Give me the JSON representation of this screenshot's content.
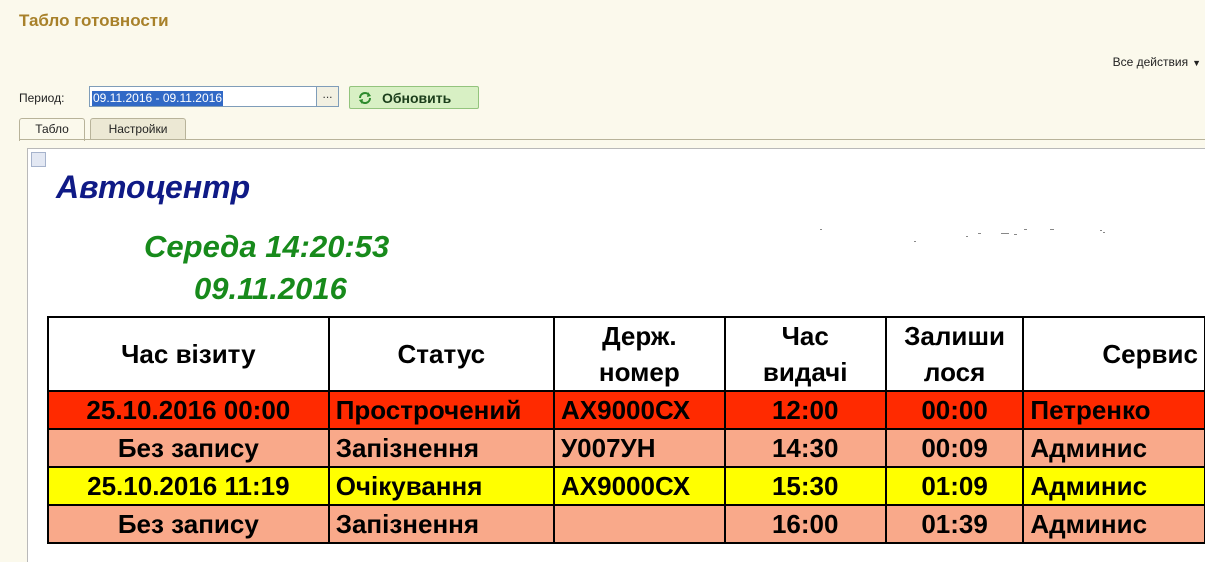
{
  "window": {
    "title": "Табло готовности"
  },
  "toolbar": {
    "all_actions": "Все действия"
  },
  "period": {
    "label": "Период:",
    "value": "09.11.2016 - 09.11.2016",
    "select_button": "...",
    "refresh_label": "Обновить"
  },
  "tabs": [
    {
      "label": "Табло",
      "active": true
    },
    {
      "label": "Настройки",
      "active": false
    }
  ],
  "board": {
    "brand": "Автоцентр",
    "day_time": "Середа 14:20:53",
    "date": "09.11.2016",
    "columns": [
      "Час візиту",
      "Статус",
      "Держ. номер",
      "Час видачі",
      "Залиши лося",
      "Сервис"
    ],
    "rows": [
      {
        "bg": "#ff2a00",
        "cells": [
          "25.10.2016 00:00",
          "Прострочений",
          "АХ9000СХ",
          "12:00",
          "00:00",
          "Петренко"
        ]
      },
      {
        "bg": "#f9a98a",
        "cells": [
          "Без запису",
          "Запізнення",
          "У007УН",
          "14:30",
          "00:09",
          "Админис"
        ]
      },
      {
        "bg": "#ffff00",
        "cells": [
          "25.10.2016 11:19",
          "Очікування",
          "АХ9000СХ",
          "15:30",
          "01:09",
          "Админис"
        ]
      },
      {
        "bg": "#f9a98a",
        "cells": [
          "Без запису",
          "Запізнення",
          "",
          "16:00",
          "01:39",
          "Админис"
        ]
      }
    ]
  },
  "colors": {
    "title": "#a8812a",
    "brand": "#0f1a86",
    "clock": "#178a1b",
    "overdue": "#ff2a00",
    "late": "#f9a98a",
    "waiting": "#ffff00"
  }
}
